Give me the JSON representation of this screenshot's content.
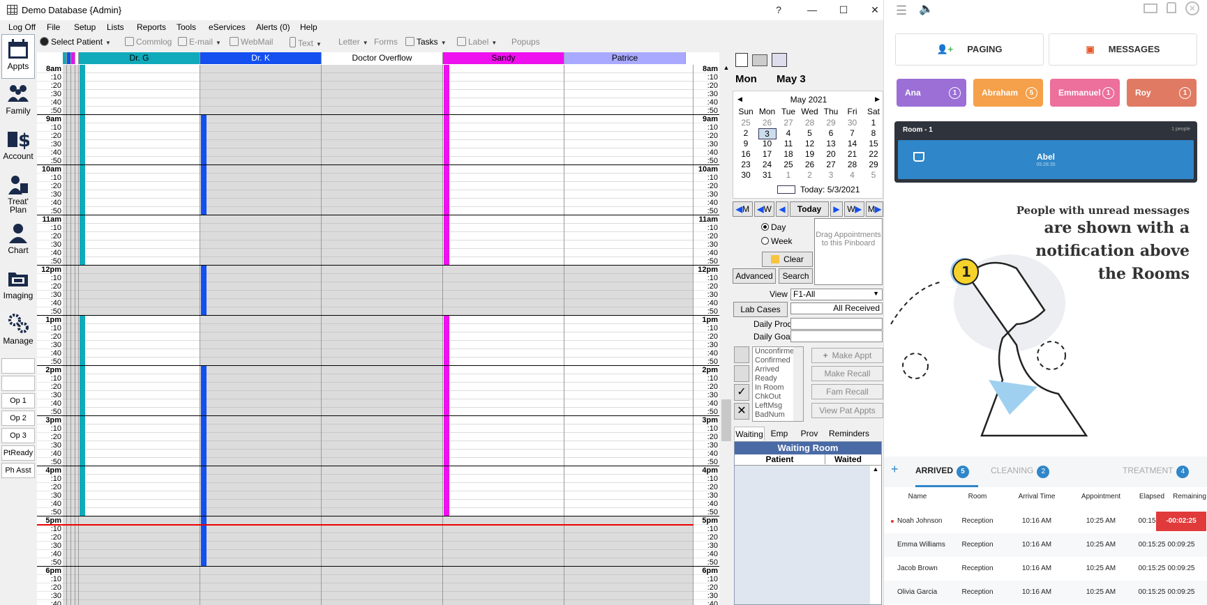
{
  "window": {
    "title": "Demo Database {Admin}",
    "help": "?",
    "minimize": "—",
    "maximize": "☐",
    "close": "✕"
  },
  "menu": [
    "Log Off",
    "File",
    "Setup",
    "Lists",
    "Reports",
    "Tools",
    "eServices",
    "Alerts (0)",
    "Help"
  ],
  "toolbar": {
    "select_patient": "Select Patient",
    "commlog": "Commlog",
    "email": "E-mail",
    "webmail": "WebMail",
    "text": "Text",
    "letter": "Letter",
    "forms": "Forms",
    "tasks": "Tasks",
    "label": "Label",
    "popups": "Popups"
  },
  "nav": [
    "Appts",
    "Family",
    "Account",
    "Treat' Plan",
    "Chart",
    "Imaging",
    "Manage"
  ],
  "ops": [
    "Op 1",
    "Op 2",
    "Op 3",
    "PtReady",
    "Ph Asst"
  ],
  "providers": [
    {
      "name": "Dr. G",
      "color": "#10aabb"
    },
    {
      "name": "Dr. K",
      "color": "#1450f0"
    },
    {
      "name": "Doctor Overflow",
      "color": "#ffffff"
    },
    {
      "name": "Sandy",
      "color": "#ee10ee"
    },
    {
      "name": "Patrice",
      "color": "#a9a9ff"
    }
  ],
  "hours": [
    "8am",
    "9am",
    "10am",
    "11am",
    "12pm",
    "1pm",
    "2pm",
    "3pm",
    "4pm",
    "5pm",
    "6pm"
  ],
  "minutes": [
    ":10",
    ":20",
    ":30",
    ":40",
    ":50"
  ],
  "date_header": {
    "dow": "Mon",
    "date": "May 3"
  },
  "calendar": {
    "month": "May 2021",
    "dow": [
      "Sun",
      "Mon",
      "Tue",
      "Wed",
      "Thu",
      "Fri",
      "Sat"
    ],
    "weeks": [
      [
        "25",
        "26",
        "27",
        "28",
        "29",
        "30",
        "1"
      ],
      [
        "2",
        "3",
        "4",
        "5",
        "6",
        "7",
        "8"
      ],
      [
        "9",
        "10",
        "11",
        "12",
        "13",
        "14",
        "15"
      ],
      [
        "16",
        "17",
        "18",
        "19",
        "20",
        "21",
        "22"
      ],
      [
        "23",
        "24",
        "25",
        "26",
        "27",
        "28",
        "29"
      ],
      [
        "30",
        "31",
        "1",
        "2",
        "3",
        "4",
        "5"
      ]
    ],
    "today": "Today: 5/3/2021"
  },
  "nav_buttons": {
    "m": "M",
    "w": "W",
    "today": "Today"
  },
  "view_mode": {
    "day": "Day",
    "week": "Week"
  },
  "pinboard": "Drag Appointments to this Pinboard",
  "buttons": {
    "clear": "Clear",
    "advanced": "Advanced",
    "search": "Search",
    "lab_cases": "Lab Cases"
  },
  "fields": {
    "view_label": "View",
    "view_value": "F1-All",
    "lab_value": "All Received",
    "daily_prod": "Daily Prod",
    "daily_goal": "Daily Goal"
  },
  "statuses": [
    "Unconfirmed",
    "Confirmed",
    "Arrived",
    "Ready",
    "In Room",
    "ChkOut",
    "LeftMsg",
    "BadNum"
  ],
  "actions": [
    "Make Appt",
    "Make Recall",
    "Fam Recall",
    "View Pat Appts"
  ],
  "bottom_tabs": [
    "Waiting",
    "Emp",
    "Prov",
    "Reminders"
  ],
  "waiting_room": {
    "title": "Waiting Room",
    "cols": [
      "Patient",
      "Waited"
    ]
  },
  "right_app": {
    "paging": "PAGING",
    "messages": "MESSAGES",
    "chips": [
      {
        "name": "Ana",
        "count": "1",
        "color": "#9b6fd6"
      },
      {
        "name": "Abraham",
        "count": "5",
        "color": "#f5a04a"
      },
      {
        "name": "Emmanuel",
        "count": "1",
        "color": "#ec6f9c"
      },
      {
        "name": "Roy",
        "count": "1",
        "color": "#e07a63"
      }
    ],
    "room": {
      "name": "Room - 1",
      "people": "1 people",
      "patient": "Abel",
      "time": "05:28:35"
    },
    "message_lines": [
      "People with unread messages",
      "are shown with a",
      "notification above",
      "the Rooms"
    ],
    "badge": "1",
    "tabs": [
      {
        "label": "ARRIVED",
        "count": "5"
      },
      {
        "label": "CLEANING",
        "count": "2"
      },
      {
        "label": "TREATMENT",
        "count": "4"
      }
    ],
    "add": "+",
    "columns": [
      "Name",
      "Room",
      "Arrival Time",
      "Appointment",
      "Elapsed",
      "Remaining"
    ],
    "rows": [
      {
        "name": "Noah Johnson",
        "room": "Reception",
        "arrival": "10:16 AM",
        "appointment": "10:25 AM",
        "elapsed": "00:15:25",
        "remaining": "-00:02:25",
        "overdue": true
      },
      {
        "name": "Emma Williams",
        "room": "Reception",
        "arrival": "10:16 AM",
        "appointment": "10:25 AM",
        "elapsed": "00:15:25",
        "remaining": "00:09:25",
        "overdue": false
      },
      {
        "name": "Jacob Brown",
        "room": "Reception",
        "arrival": "10:16 AM",
        "appointment": "10:25 AM",
        "elapsed": "00:15:25",
        "remaining": "00:09:25",
        "overdue": false
      },
      {
        "name": "Olivia Garcia",
        "room": "Reception",
        "arrival": "10:16 AM",
        "appointment": "10:25 AM",
        "elapsed": "00:15:25",
        "remaining": "00:09:25",
        "overdue": false
      }
    ]
  }
}
